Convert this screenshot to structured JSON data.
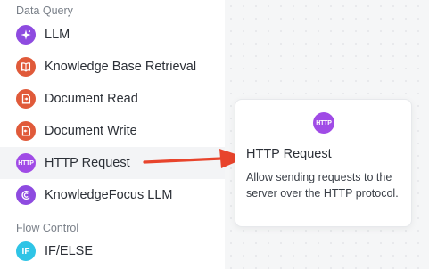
{
  "sidebar": {
    "sections": [
      {
        "title": "Data Query",
        "items": [
          {
            "label": "LLM",
            "icon": "sparkle-icon",
            "color": "#8e4be0"
          },
          {
            "label": "Knowledge Base Retrieval",
            "icon": "book-icon",
            "color": "#e05a3a"
          },
          {
            "label": "Document Read",
            "icon": "document-read-icon",
            "color": "#e05a3a"
          },
          {
            "label": "Document Write",
            "icon": "document-write-icon",
            "color": "#e05a3a"
          },
          {
            "label": "HTTP Request",
            "icon": "http-icon",
            "icon_text": "HTTP",
            "color": "#a04be6",
            "selected": true
          },
          {
            "label": "KnowledgeFocus LLM",
            "icon": "knowledge-focus-icon",
            "color": "#8e4be0"
          }
        ]
      },
      {
        "title": "Flow Control",
        "items": [
          {
            "label": "IF/ELSE",
            "icon": "if-else-icon",
            "icon_text": "IF",
            "color": "#2ec4e6"
          }
        ]
      }
    ]
  },
  "tooltip": {
    "icon": "http-icon",
    "icon_text": "HTTP",
    "title": "HTTP Request",
    "description": "Allow sending requests to the server over the HTTP protocol."
  },
  "colors": {
    "arrow": "#e8442c",
    "purple": "#a04be6",
    "orange": "#e05a3a",
    "cyan": "#2ec4e6"
  }
}
